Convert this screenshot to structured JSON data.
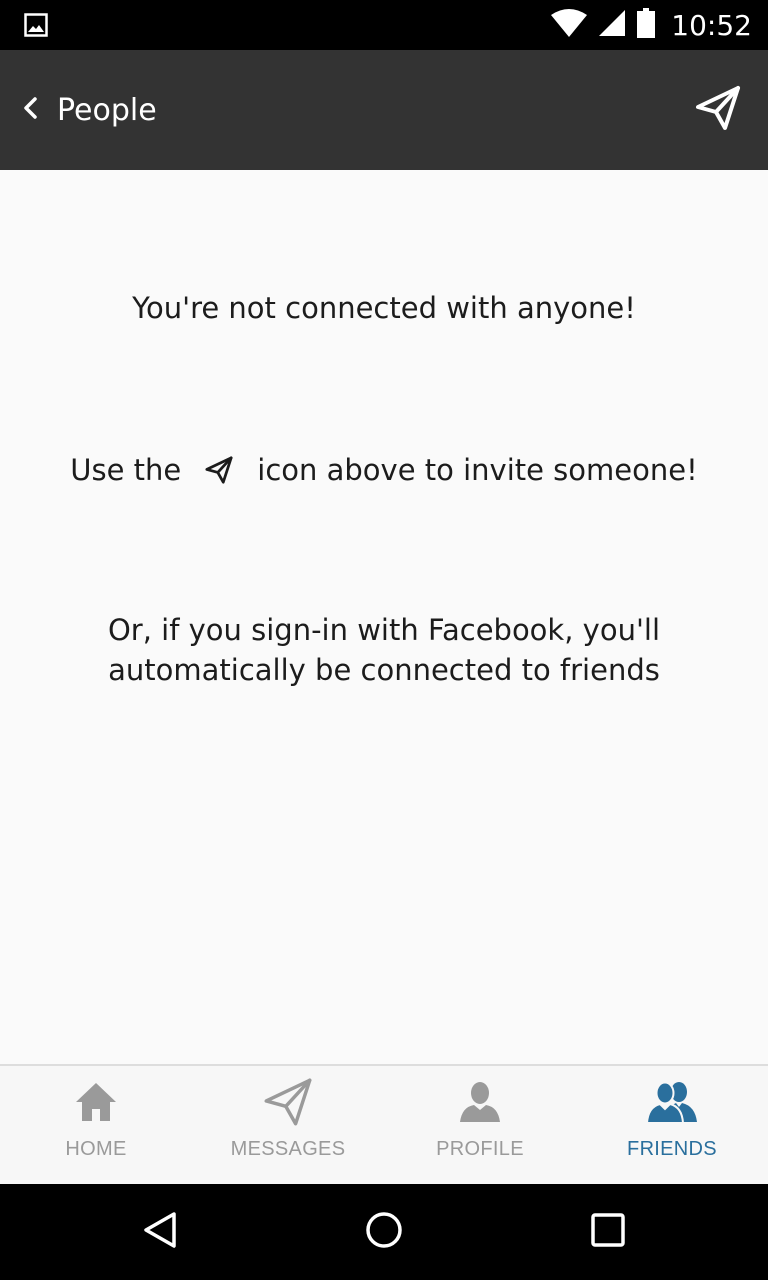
{
  "status_bar": {
    "time": "10:52",
    "icons": [
      "image-icon",
      "wifi-icon",
      "signal-icon",
      "battery-icon"
    ]
  },
  "app_bar": {
    "title": "People",
    "back_icon": "chevron-left-icon",
    "action_icon": "paper-plane-icon"
  },
  "content": {
    "line1": "You're not connected with anyone!",
    "line2_before": "Use the",
    "line2_after": "icon above to invite someone!",
    "line3a": "Or, if you sign-in with Facebook, you'll",
    "line3b": "automatically be connected to friends"
  },
  "bottom_nav": {
    "items": [
      {
        "label": "HOME",
        "icon": "home-icon",
        "active": false
      },
      {
        "label": "MESSAGES",
        "icon": "paper-plane-icon",
        "active": false
      },
      {
        "label": "PROFILE",
        "icon": "person-icon",
        "active": false
      },
      {
        "label": "FRIENDS",
        "icon": "friends-icon",
        "active": true
      }
    ]
  },
  "colors": {
    "app_bar": "#333333",
    "background": "#fafafa",
    "active_tab": "#2a6f9d",
    "inactive_tab": "#9a9a9a"
  }
}
